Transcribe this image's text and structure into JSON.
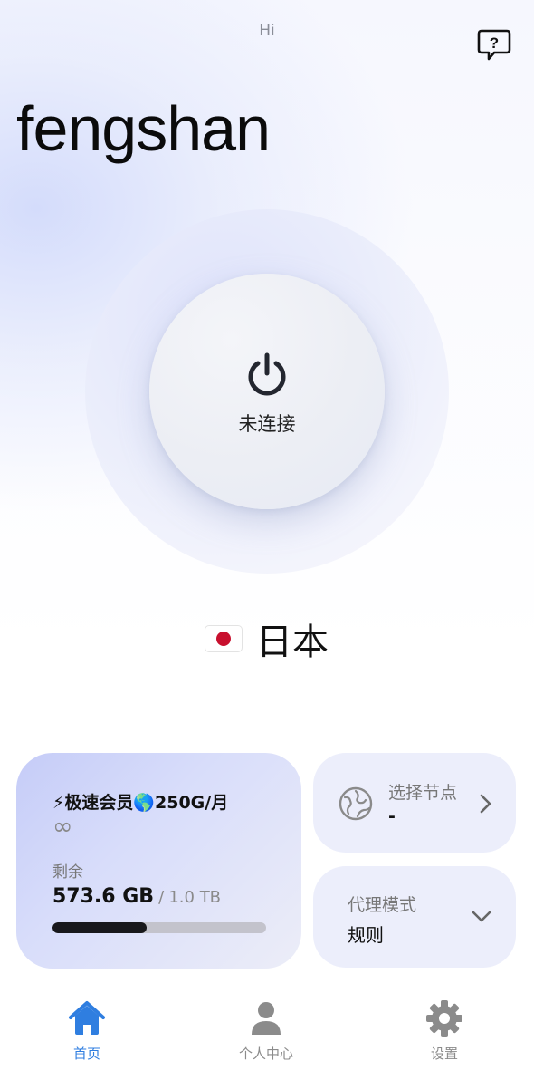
{
  "header": {
    "greeting": "Hi",
    "username": "fengshan",
    "help_icon": "question-bubble-icon"
  },
  "connection": {
    "status": "未连接",
    "icon": "power-icon"
  },
  "location": {
    "flag_icon": "japan-flag-icon",
    "country": "日本"
  },
  "plan": {
    "title": "⚡极速会员🌎250G/月",
    "validity": "∞",
    "remaining_label": "剩余",
    "remaining_value": "573.6 GB",
    "separator": "/",
    "total": "1.0 TB",
    "remaining_fraction": 0.44
  },
  "node": {
    "label": "选择节点",
    "value": "-",
    "icon": "globe-icon"
  },
  "proxy_mode": {
    "label": "代理模式",
    "value": "规则"
  },
  "tabs": [
    {
      "label": "首页",
      "icon": "home-icon",
      "active": true
    },
    {
      "label": "个人中心",
      "icon": "user-icon",
      "active": false
    },
    {
      "label": "设置",
      "icon": "gear-icon",
      "active": false
    }
  ],
  "colors": {
    "accent": "#2f7ee0",
    "inactive_tab": "#8b8b8b",
    "progress_fill": "#18181c",
    "progress_track": "#c3c3cc"
  }
}
